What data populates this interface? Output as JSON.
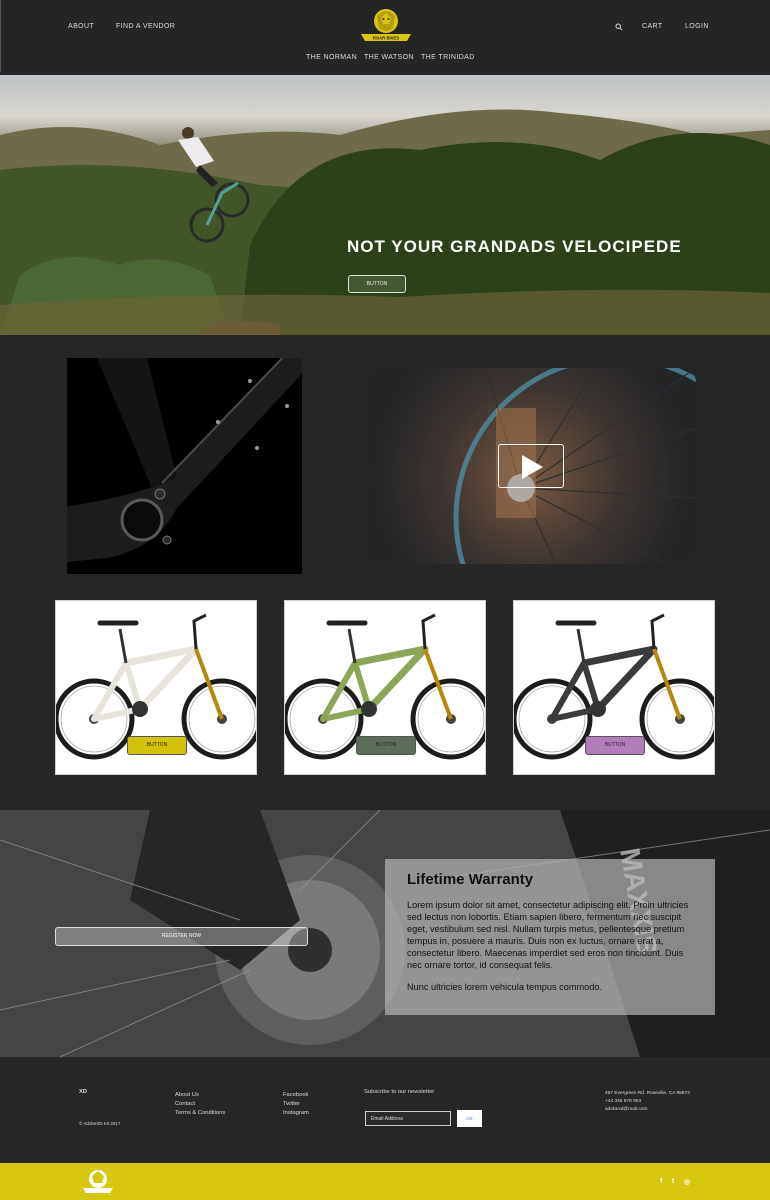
{
  "header": {
    "nav_left": [
      "ABOUT",
      "FIND A VENDOR"
    ],
    "cart": "CART",
    "login": "LOGIN",
    "sub_nav": [
      "THE NORMAN",
      "THE WATSON",
      "THE TRINIDAD"
    ],
    "logo_text": "ROAR BIKES"
  },
  "hero": {
    "title": "NOT YOUR GRANDADS VELOCIPEDE",
    "button_label": "BUTTON"
  },
  "products": [
    {
      "button_label": "BUTTON",
      "button_color": "#d4c20a",
      "frame_color": "#e8e4dc"
    },
    {
      "button_label": "BUTTON",
      "button_color": "#5c6e5a",
      "frame_color": "#8aa656"
    },
    {
      "button_label": "BUTTON",
      "button_color": "#b27cbb",
      "frame_color": "#3b3b3d"
    }
  ],
  "warranty": {
    "register_label": "REGISTER NOW",
    "title": "Lifetime Warranty",
    "body": "Lorem ipsum dolor sit amet, consectetur adipiscing elit. Proin ultricies sed lectus non lobortis. Etiam sapien libero, fermentum nec suscipit eget, vestibulum sed nisl. Nullam turpis metus, pellentesque pretium tempus in, posuere a mauris. Duis non ex luctus, ornare erat a, consectetur libero. Maecenas imperdiet sed eros non tincidunt. Duis nec ornare tortor, id consequat felis.",
    "footer_line": "Nunc ultricies lorem vehicula tempus commodo."
  },
  "footer": {
    "brand": "XD",
    "copyright": "© AdobeXD Kit 2017",
    "links_col1": [
      "About Us",
      "Contact",
      "Terms & Conditions"
    ],
    "links_col2": [
      "Facebook",
      "Twitter",
      "Instagram"
    ],
    "newsletter_label": "Subscribe to our newsletter",
    "email_placeholder": "Email Address",
    "ok_label": "OK",
    "address": [
      "497 Evergreen Rd. Roseville, CA 95673",
      "+44 345 678 903",
      "adobexd@mail.com"
    ]
  },
  "bottom_bar": {
    "color": "#d6c70e",
    "social_icons": [
      "facebook-icon",
      "twitter-icon",
      "instagram-icon"
    ],
    "social_glyphs": [
      "f",
      "t",
      "◎"
    ]
  }
}
